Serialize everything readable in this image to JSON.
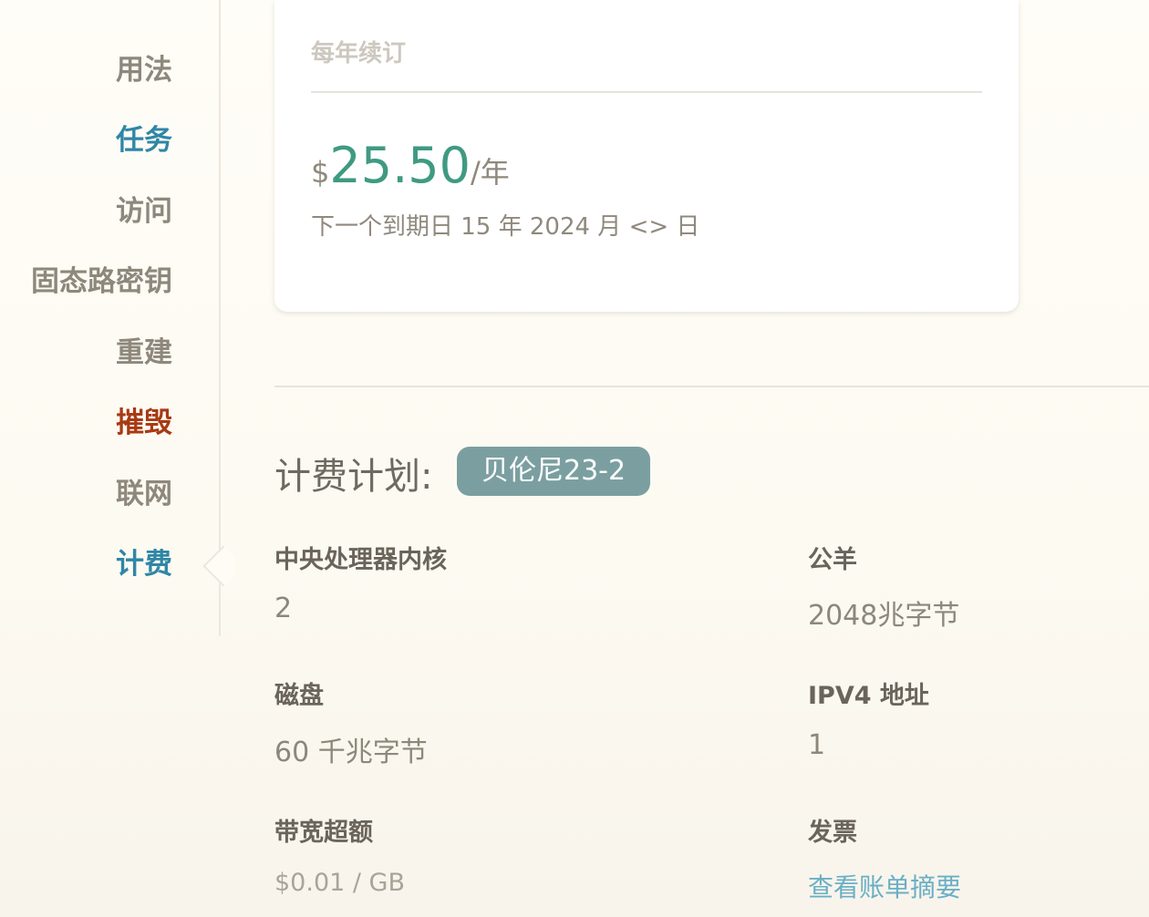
{
  "sidebar": {
    "items": [
      {
        "label": "用法",
        "color": "#8e887c"
      },
      {
        "label": "任务",
        "color": "#2f86a6"
      },
      {
        "label": "访问",
        "color": "#8e887c"
      },
      {
        "label": "固态路密钥",
        "color": "#8e887c"
      },
      {
        "label": "重建",
        "color": "#8e887c"
      },
      {
        "label": "摧毁",
        "color": "#a83a14"
      },
      {
        "label": "联网",
        "color": "#8e887c"
      },
      {
        "label": "计费",
        "color": "#2f86a6",
        "active": true
      }
    ]
  },
  "renewal_card": {
    "title": "每年续订",
    "currency": "$",
    "amount": "25.50",
    "unit": "/年",
    "due_text": "下一个到期日 15 年 2024 月 <> 日"
  },
  "plan": {
    "heading": "计费计划:",
    "badge": "贝伦尼23-2"
  },
  "specs": {
    "cpu": {
      "label": "中央处理器内核",
      "value": "2"
    },
    "ram": {
      "label": "公羊",
      "value": "2048兆字节"
    },
    "disk": {
      "label": "磁盘",
      "value": "60 千兆字节"
    },
    "ipv4": {
      "label": "IPV4 地址",
      "value": "1"
    },
    "bandwidth": {
      "label": "带宽超额",
      "value": "$0.01 / GB"
    },
    "invoice": {
      "label": "发票",
      "link": "查看账单摘要"
    }
  },
  "colors": {
    "accent_green": "#3f9a82",
    "link_blue": "#6aafc6",
    "badge_bg": "#7b9fa0",
    "danger": "#a83a14"
  }
}
